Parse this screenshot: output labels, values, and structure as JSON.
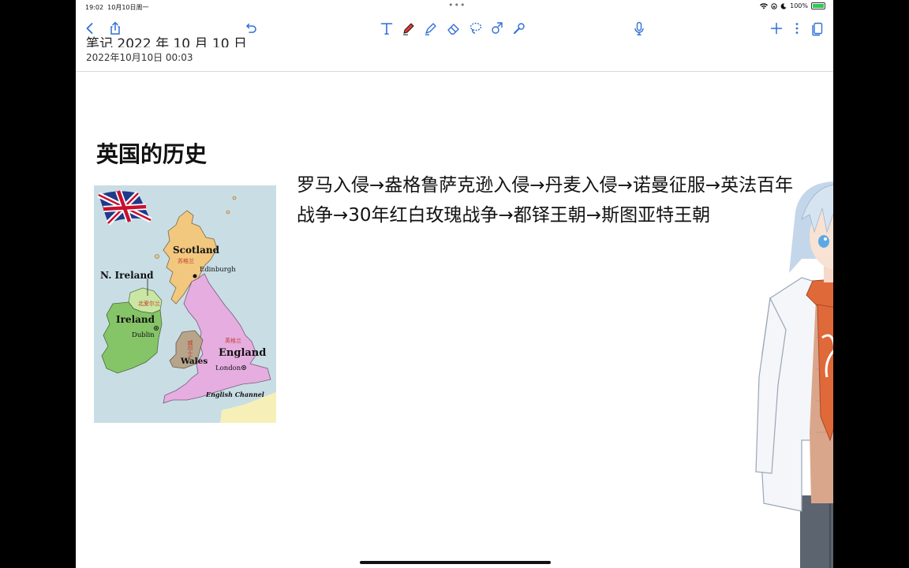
{
  "status": {
    "time": "19:02",
    "date": "10月10日周一",
    "battery": "100%"
  },
  "toolbar": {
    "icons": [
      "back-icon",
      "share-icon",
      "undo-icon",
      "text-tool-icon",
      "pen-icon",
      "highlighter-icon",
      "eraser-icon",
      "lasso-icon",
      "shapes-icon",
      "laser-pointer-icon",
      "microphone-icon",
      "add-icon",
      "more-icon",
      "pages-icon"
    ],
    "pen_color": "#e53935",
    "accent": "#2f6fd6"
  },
  "document": {
    "title": "笔记 2022 年 10 月 10 日",
    "created": "2022年10月10日 00:03",
    "heading": "英国的历史",
    "history_text": "罗马入侵→盎格鲁萨克逊入侵→丹麦入侵→诺曼征服→英法百年战争→30年红白玫瑰战争→都铎王朝→斯图亚特王朝"
  },
  "map": {
    "labels": {
      "scotland": "Scotland",
      "scotland_cn": "苏格兰",
      "edinburgh": "Edinburgh",
      "n_ireland": "N. Ireland",
      "n_ireland_cn": "北爱尔兰",
      "ireland": "Ireland",
      "dublin": "Dublin",
      "wales": "Wales",
      "wales_cn": "威尔士",
      "england": "England",
      "england_cn": "英格兰",
      "london": "London",
      "channel": "English Channel"
    },
    "colors": {
      "sea": "#c9dde5",
      "scotland": "#f2c77e",
      "england": "#e6aee0",
      "wales": "#b7a48a",
      "ireland": "#86c468",
      "n_ireland": "#c9e6a3"
    }
  }
}
